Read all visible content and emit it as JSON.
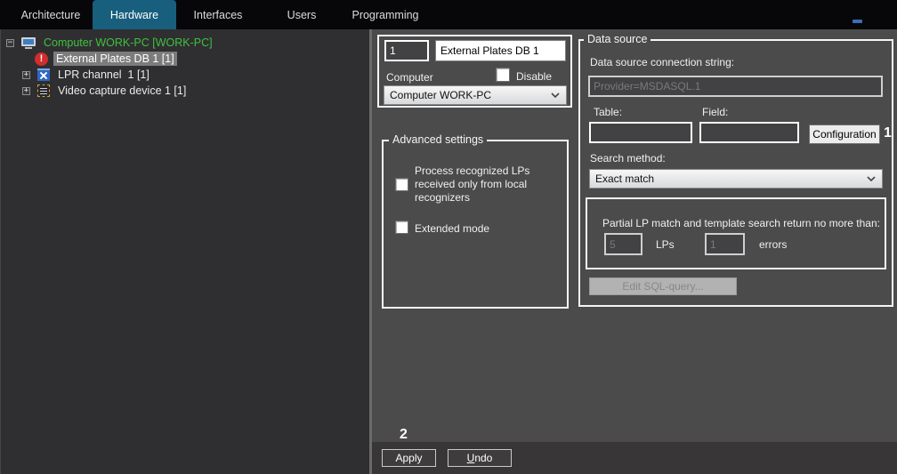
{
  "colors": {
    "active_tab": "#185e7d",
    "computer_ok_green": "#3fc13f",
    "alert_red": "#d22d2c",
    "lpr_blue": "#2f66c4",
    "chip_orange": "#d99a3c",
    "selection_gray": "#7c7c7c"
  },
  "nav": {
    "tabs": [
      {
        "label": "Architecture",
        "active": false
      },
      {
        "label": "Hardware",
        "active": true
      },
      {
        "label": "Interfaces",
        "active": false
      },
      {
        "label": "Users",
        "active": false
      },
      {
        "label": "Programming",
        "active": false
      }
    ]
  },
  "tree": {
    "expand_minus": "−",
    "expand_plus": "+",
    "items": [
      {
        "label": "Computer WORK-PC [WORK-PC]",
        "icon": "computer-icon",
        "state": "expanded",
        "color": "green"
      },
      {
        "label": "External Plates DB 1 [1]",
        "icon": "alert-icon",
        "state": "leaf",
        "selected": true
      },
      {
        "label": "LPR channel  1 [1]",
        "icon": "lpr-icon",
        "state": "collapsed"
      },
      {
        "label": "Video capture device 1 [1]",
        "icon": "video-capture-icon",
        "state": "collapsed"
      }
    ],
    "alert_glyph": "!"
  },
  "general": {
    "id_value": "1",
    "name_value": "External Plates DB 1",
    "computer_label": "Computer",
    "disable_label": "Disable",
    "computer_value": "Computer WORK-PC"
  },
  "advanced": {
    "title": "Advanced settings",
    "checkbox1_label": "Process recognized LPs received only from local recognizers",
    "checkbox2_label": "Extended mode"
  },
  "data_source": {
    "title": "Data source",
    "connection_label": "Data source connection string:",
    "connection_value": "Provider=MSDASQL.1",
    "table_label": "Table:",
    "field_label": "Field:",
    "configuration_label": "Configuration",
    "marker1": "1",
    "search_method_label": "Search method:",
    "search_method_value": "Exact match",
    "partial_label": "Partial LP match and template search return no more than:",
    "lps_value": "5",
    "lps_label": "LPs",
    "errors_value": "1",
    "errors_label": "errors",
    "edit_sql_label": "Edit SQL-query..."
  },
  "footer": {
    "marker2": "2",
    "apply_label": "Apply",
    "undo_accel": "U",
    "undo_rest": "ndo"
  }
}
